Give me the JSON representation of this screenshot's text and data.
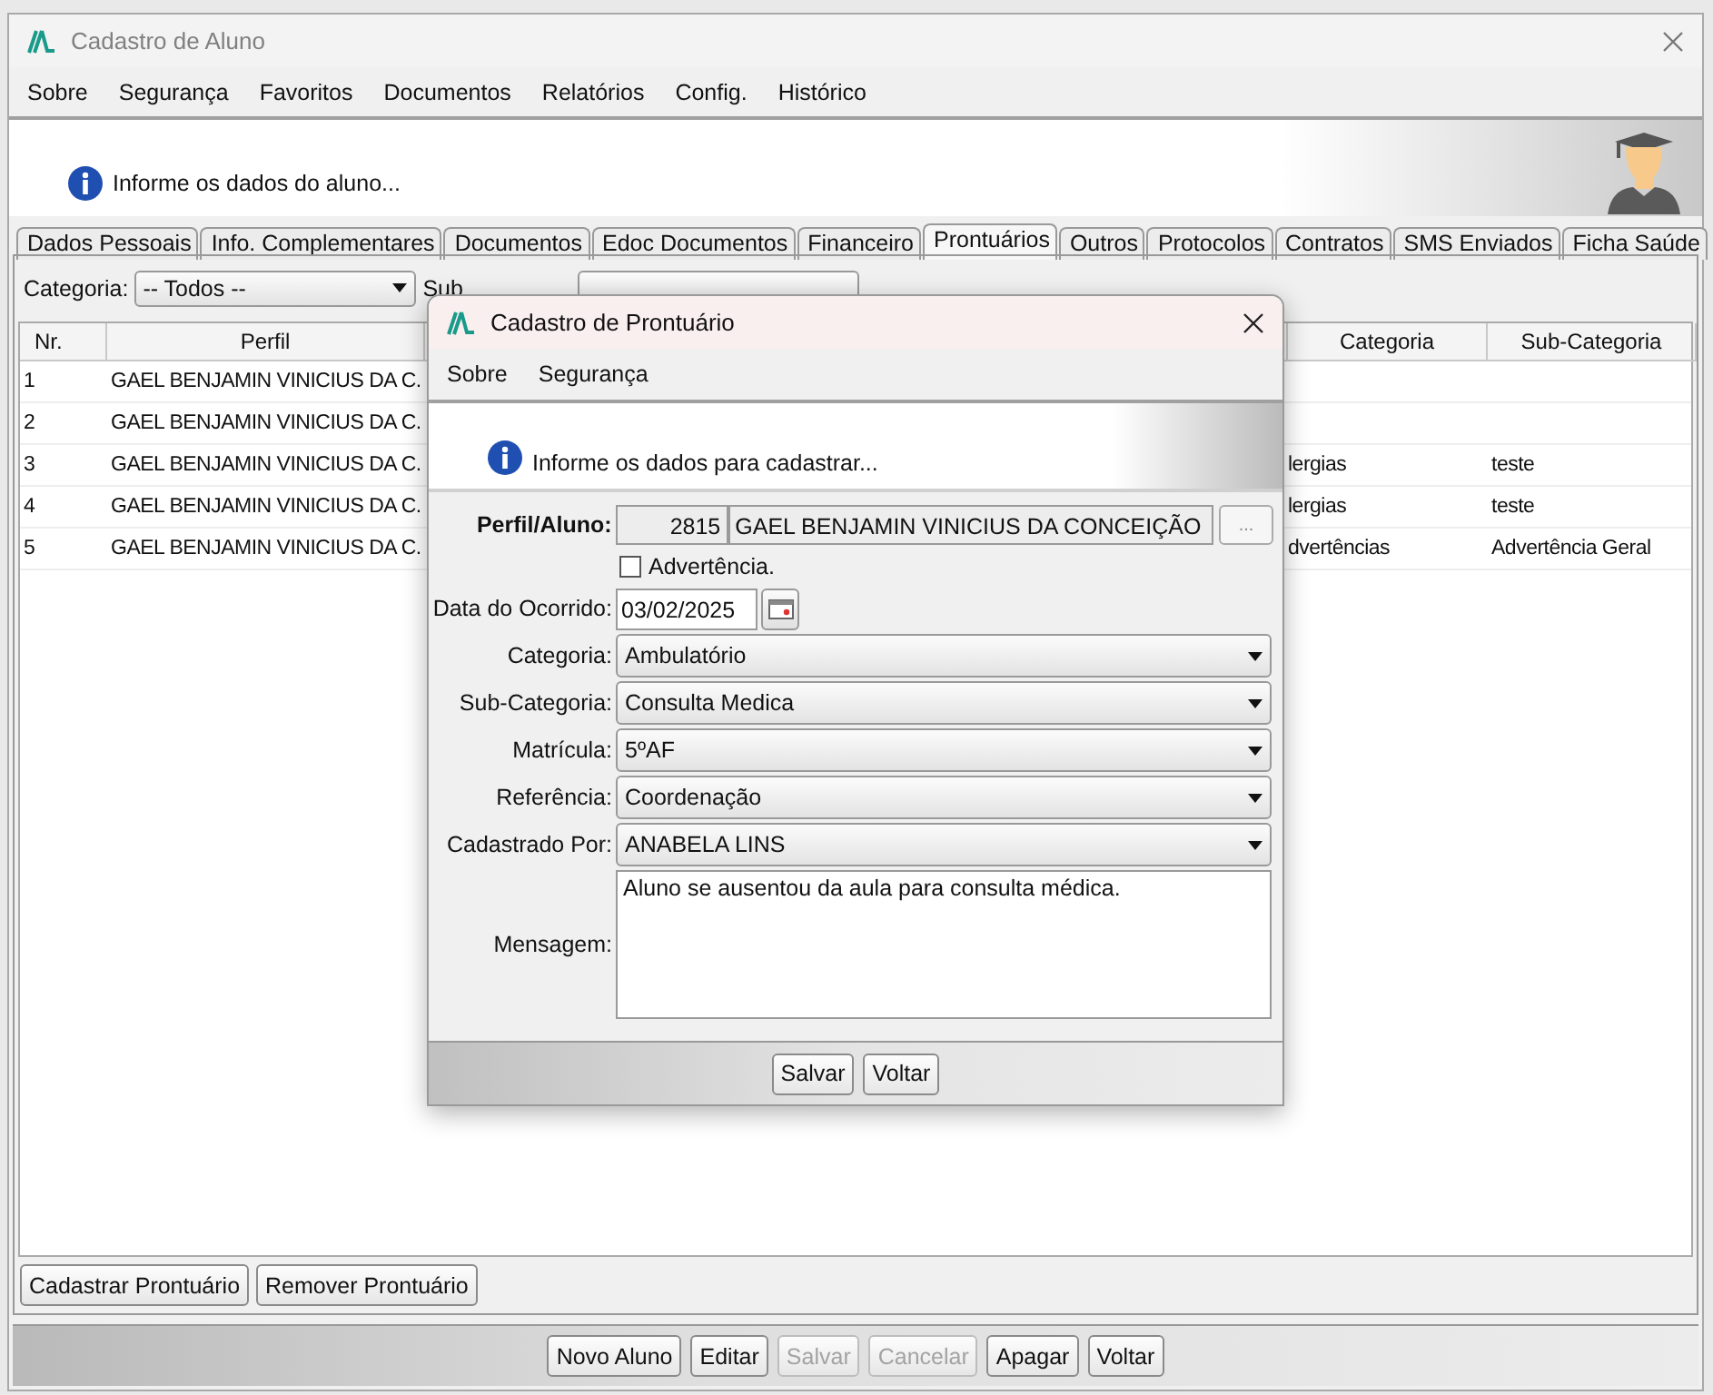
{
  "window": {
    "title": "Cadastro de Aluno"
  },
  "menu": [
    "Sobre",
    "Segurança",
    "Favoritos",
    "Documentos",
    "Relatórios",
    "Config.",
    "Histórico"
  ],
  "header": {
    "message": "Informe os dados do aluno..."
  },
  "tabs": [
    {
      "label": "Dados Pessoais",
      "selected": false
    },
    {
      "label": "Info. Complementares",
      "selected": false
    },
    {
      "label": "Documentos",
      "selected": false
    },
    {
      "label": "Edoc Documentos",
      "selected": false
    },
    {
      "label": "Financeiro",
      "selected": false
    },
    {
      "label": "Prontuários",
      "selected": true
    },
    {
      "label": "Outros",
      "selected": false
    },
    {
      "label": "Protocolos",
      "selected": false
    },
    {
      "label": "Contratos",
      "selected": false
    },
    {
      "label": "SMS Enviados",
      "selected": false
    },
    {
      "label": "Ficha Saúde",
      "selected": false
    }
  ],
  "filter": {
    "category_label": "Categoria:",
    "category_value": "-- Todos --",
    "subcategory_label": "Sub"
  },
  "table": {
    "columns": [
      "Nr.",
      "Perfil",
      "Categoria",
      "Sub-Categoria"
    ],
    "rows": [
      {
        "nr": "1",
        "perfil": "GAEL BENJAMIN VINICIUS DA C."
      },
      {
        "nr": "2",
        "perfil": "GAEL BENJAMIN VINICIUS DA C."
      },
      {
        "nr": "3",
        "perfil": "GAEL BENJAMIN VINICIUS DA C.",
        "categoria": "lergias",
        "sub_categoria": "teste"
      },
      {
        "nr": "4",
        "perfil": "GAEL BENJAMIN VINICIUS DA C.",
        "categoria": "lergias",
        "sub_categoria": "teste"
      },
      {
        "nr": "5",
        "perfil": "GAEL BENJAMIN VINICIUS DA C.",
        "categoria": "dvertências",
        "sub_categoria": "Advertência Geral"
      }
    ]
  },
  "record_buttons": [
    "Cadastrar Prontuário",
    "Remover Prontuário"
  ],
  "footer_buttons": [
    {
      "label": "Novo Aluno",
      "disabled": false
    },
    {
      "label": "Editar",
      "disabled": false
    },
    {
      "label": "Salvar",
      "disabled": true
    },
    {
      "label": "Cancelar",
      "disabled": true
    },
    {
      "label": "Apagar",
      "disabled": false
    },
    {
      "label": "Voltar",
      "disabled": false
    }
  ],
  "dialog": {
    "title": "Cadastro de Prontuário",
    "menu": [
      "Sobre",
      "Segurança"
    ],
    "message": "Informe os dados para cadastrar...",
    "profile": {
      "label": "Perfil/Aluno:",
      "code": "2815",
      "name": "GAEL BENJAMIN VINICIUS DA CONCEIÇÃO",
      "browse": "..."
    },
    "warning": {
      "label": "Advertência.",
      "checked": false
    },
    "date": {
      "label": "Data do Ocorrido:",
      "value": "03/02/2025"
    },
    "selects": [
      {
        "label": "Categoria:",
        "value": "Ambulatório"
      },
      {
        "label": "Sub-Categoria:",
        "value": "Consulta Medica"
      },
      {
        "label": "Matrícula:",
        "value": "5ºAF"
      },
      {
        "label": "Referência:",
        "value": "Coordenação"
      },
      {
        "label": "Cadastrado Por:",
        "value": "ANABELA LINS"
      }
    ],
    "note": {
      "label": "Mensagem:",
      "value": "Aluno se ausentou da aula para consulta médica."
    },
    "buttons": [
      "Salvar",
      "Voltar"
    ]
  }
}
